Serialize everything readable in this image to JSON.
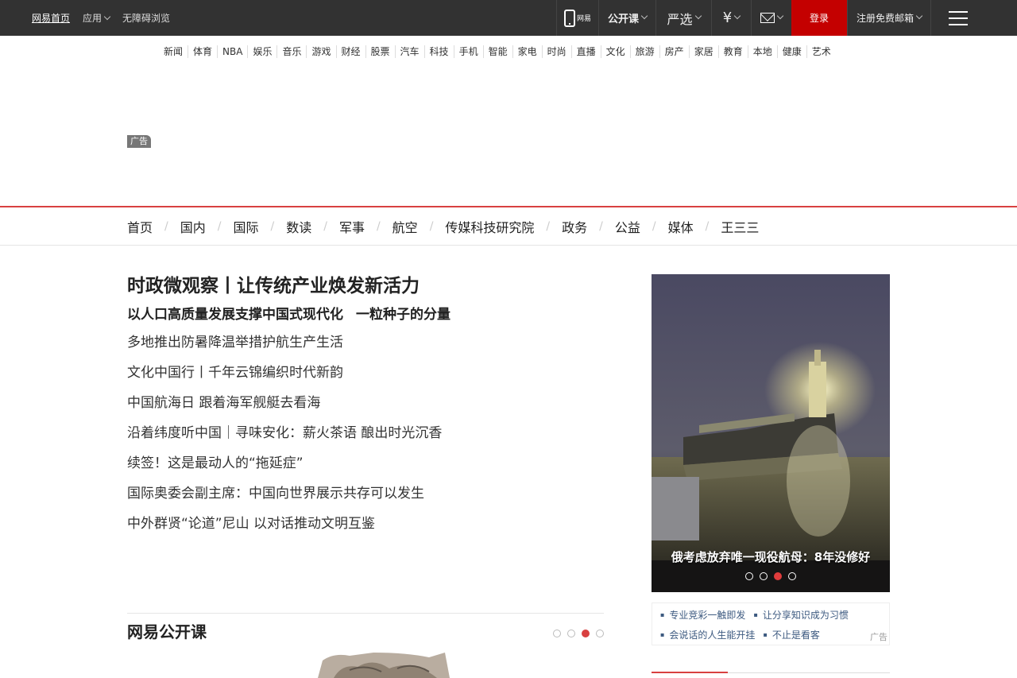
{
  "topbar": {
    "left_links": [
      "网易首页",
      "应用",
      "无障碍浏览"
    ],
    "phone_label": "网易",
    "open_course": "公开课",
    "yanxuan": "严选",
    "money_icon": "yen-icon",
    "login": "登录",
    "register": "注册免费邮箱"
  },
  "channels": [
    "新闻",
    "体育",
    "NBA",
    "娱乐",
    "音乐",
    "游戏",
    "财经",
    "股票",
    "汽车",
    "科技",
    "手机",
    "智能",
    "家电",
    "时尚",
    "直播",
    "文化",
    "旅游",
    "房产",
    "家居",
    "教育",
    "本地",
    "健康",
    "艺术"
  ],
  "ad_label": "广告",
  "section_nav": [
    "首页",
    "国内",
    "国际",
    "数读",
    "军事",
    "航空",
    "传媒科技研究院",
    "政务",
    "公益",
    "媒体",
    "王三三"
  ],
  "headline": "时政微观察丨让传统产业焕发新活力",
  "sub_headlines": [
    "以人口高质量发展支撑中国式现代化",
    "一粒种子的分量"
  ],
  "news": [
    "多地推出防暑降温举措护航生产生活",
    "文化中国行丨千年云锦编织时代新韵",
    "中国航海日 跟着海军舰艇去看海",
    "沿着纬度听中国｜寻味安化：薪火茶语 酿出时光沉香",
    "续签！这是最动人的“拖延症”",
    "国际奥委会副主席：中国向世界展示共存可以发生",
    "中外群贤“论道”尼山 以对话推动文明互鉴"
  ],
  "slideshow": {
    "caption": "俄考虑放弃唯一现役航母：8年没修好",
    "active_index": 2,
    "count": 4
  },
  "slide_links": {
    "row1": [
      "专业竞彩一触即发",
      "让分享知识成为习惯"
    ],
    "row2": [
      "会说话的人生能开挂",
      "不止是看客"
    ],
    "ad": "广告"
  },
  "open_course": {
    "title": "网易公开课",
    "active_index": 2,
    "count": 4
  }
}
